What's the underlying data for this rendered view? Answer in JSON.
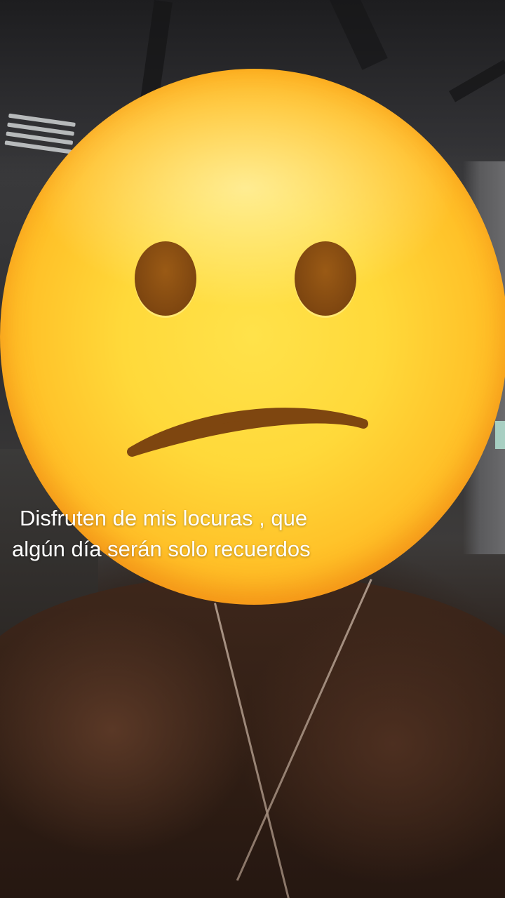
{
  "video": {
    "overlay_sticker": "confused-face-emoji-icon",
    "caption": {
      "line1": "Disfruten de mis locuras , que",
      "line2": "algún día serán solo recuerdos"
    }
  },
  "colors": {
    "emoji_yellow": "#ffd93a",
    "emoji_orange": "#f48a12",
    "emoji_features": "#7e4610",
    "caption_text": "#ffffff"
  }
}
